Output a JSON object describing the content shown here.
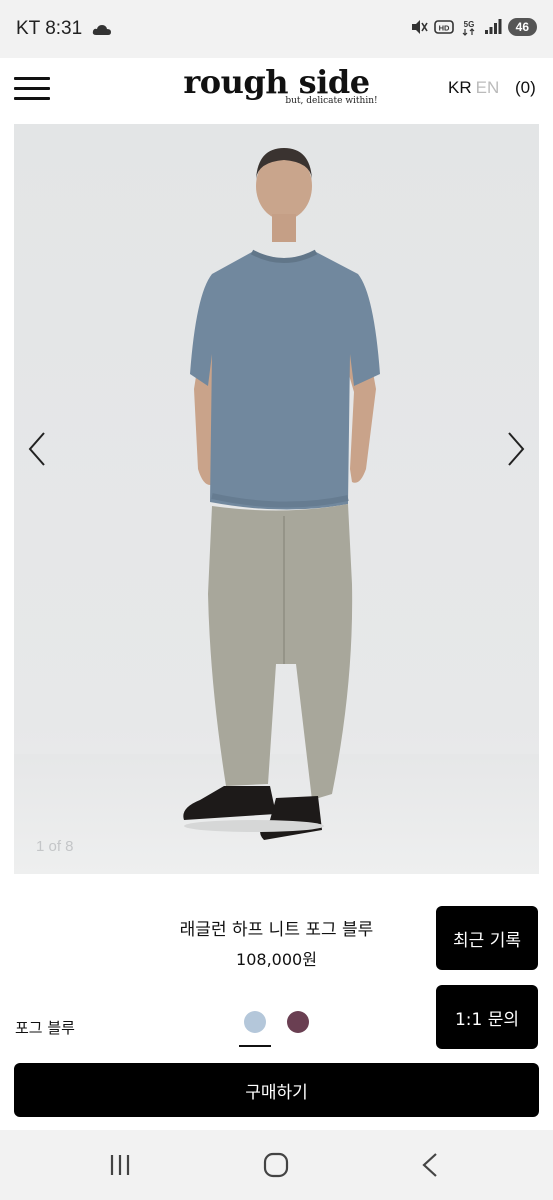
{
  "status_bar": {
    "carrier_time": "KT 8:31",
    "battery": "46",
    "icons": [
      "cloud-icon",
      "mute-icon",
      "hd-icon",
      "5g-icon",
      "signal-icon"
    ]
  },
  "header": {
    "logo_title": "rough side",
    "logo_subtitle": "but, delicate within!",
    "lang_kr": "KR",
    "lang_en": "EN",
    "cart": "(0)"
  },
  "gallery": {
    "counter": "1 of 8"
  },
  "product": {
    "name": "래글런 하프 니트 포그 블루",
    "price": "108,000원",
    "selected_color": "포그 블루",
    "swatch_colors": [
      "#b4c7da",
      "#6a3f52"
    ]
  },
  "buttons": {
    "recent": "최근 기록",
    "inquiry": "1:1 문의",
    "buy": "구매하기"
  }
}
